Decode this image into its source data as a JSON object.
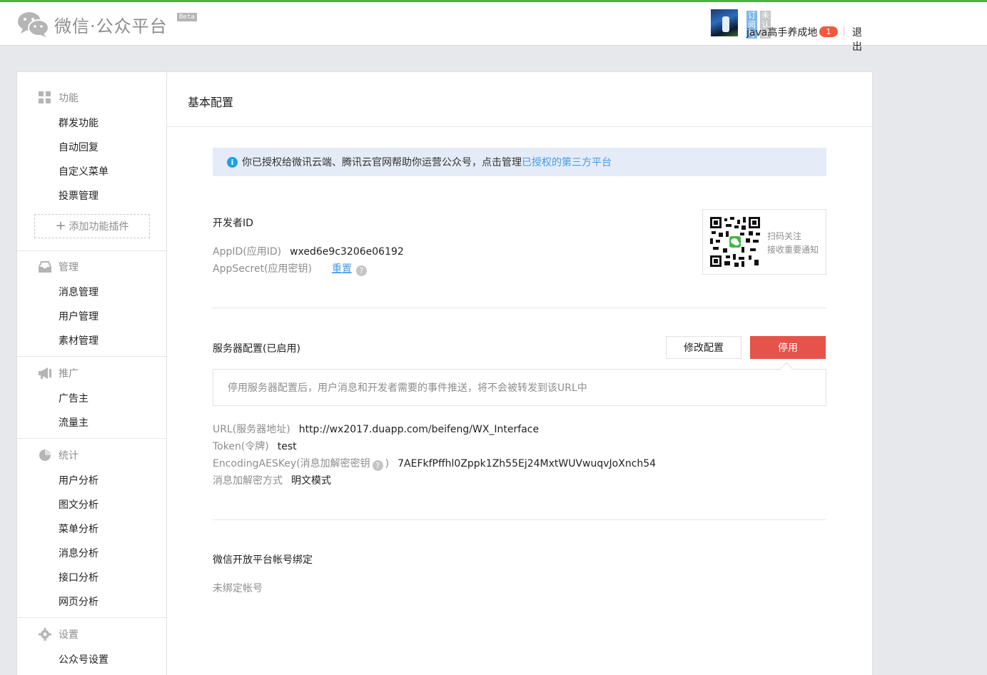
{
  "header": {
    "logo_text": "微信·公众平台",
    "beta": "Beta",
    "tags": [
      "订阅号",
      "未认证"
    ],
    "account_name": "java高手养成地",
    "notification_count": "1",
    "logout": "退出"
  },
  "sidebar": {
    "groups": [
      {
        "title": "功能",
        "icon": "grid-icon",
        "items": [
          "群发功能",
          "自动回复",
          "自定义菜单",
          "投票管理"
        ]
      },
      {
        "title": "管理",
        "icon": "inbox-icon",
        "items": [
          "消息管理",
          "用户管理",
          "素材管理"
        ]
      },
      {
        "title": "推广",
        "icon": "megaphone-icon",
        "items": [
          "广告主",
          "流量主"
        ]
      },
      {
        "title": "统计",
        "icon": "pie-chart-icon",
        "items": [
          "用户分析",
          "图文分析",
          "菜单分析",
          "消息分析",
          "接口分析",
          "网页分析"
        ]
      },
      {
        "title": "设置",
        "icon": "gear-icon",
        "items": [
          "公众号设置"
        ]
      }
    ],
    "add_plugin": "添加功能插件"
  },
  "main": {
    "title": "基本配置",
    "notice": {
      "text": "你已授权给微讯云端、腾讯云官网帮助你运营公众号，点击管理",
      "link": "已授权的第三方平台"
    },
    "developer": {
      "title": "开发者ID",
      "appid_label": "AppID(应用ID)",
      "appid_value": "wxed6e9c3206e06192",
      "secret_label": "AppSecret(应用密钥)",
      "secret_action": "重置",
      "qr_line1": "扫码关注",
      "qr_line2": "接收重要通知"
    },
    "server": {
      "title": "服务器配置(已启用)",
      "modify_button": "修改配置",
      "disable_button": "停用",
      "tip": "停用服务器配置后，用户消息和开发者需要的事件推送，将不会被转发到该URL中",
      "url_label": "URL(服务器地址)",
      "url_value": "http://wx2017.duapp.com/beifeng/WX_Interface",
      "token_label": "Token(令牌)",
      "token_value": "test",
      "aes_label": "EncodingAESKey(消息加解密密钥",
      "aes_label_end": ")",
      "aes_value": "7AEFkfPffhl0Zppk1Zh55Ej24MxtWUVwuqvJoXnch54",
      "mode_label": "消息加解密方式",
      "mode_value": "明文模式"
    },
    "open_platform": {
      "title": "微信开放平台帐号绑定",
      "status": "未绑定帐号"
    }
  },
  "colors": {
    "accent": "#44b549",
    "link": "#459ae9",
    "danger": "#e5534b",
    "badge": "#f05a3c"
  }
}
